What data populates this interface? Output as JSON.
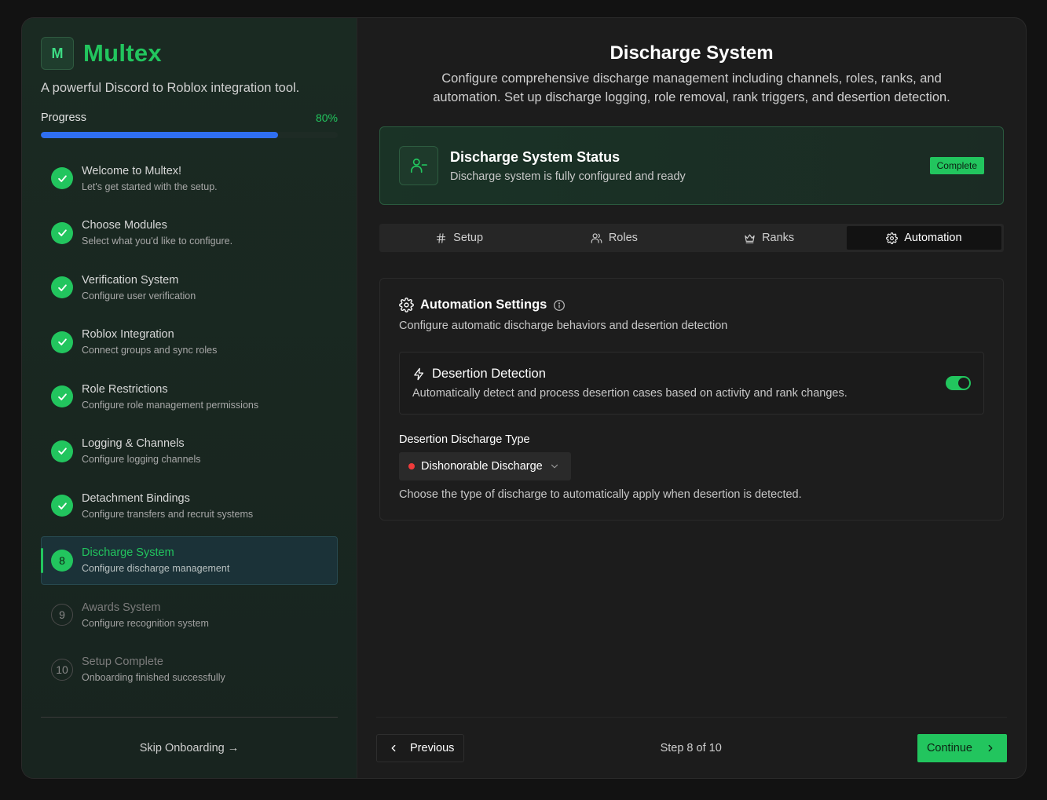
{
  "brand": {
    "logo_letter": "M",
    "name": "Multex",
    "tagline": "A powerful Discord to Roblox integration tool."
  },
  "progress": {
    "label": "Progress",
    "percent_text": "80%",
    "percent": 80
  },
  "steps": [
    {
      "number": "1",
      "title": "Welcome to Multex!",
      "subtitle": "Let's get started with the setup.",
      "state": "done"
    },
    {
      "number": "2",
      "title": "Choose Modules",
      "subtitle": "Select what you'd like to configure.",
      "state": "done"
    },
    {
      "number": "3",
      "title": "Verification System",
      "subtitle": "Configure user verification",
      "state": "done"
    },
    {
      "number": "4",
      "title": "Roblox Integration",
      "subtitle": "Connect groups and sync roles",
      "state": "done"
    },
    {
      "number": "5",
      "title": "Role Restrictions",
      "subtitle": "Configure role management permissions",
      "state": "done"
    },
    {
      "number": "6",
      "title": "Logging & Channels",
      "subtitle": "Configure logging channels",
      "state": "done"
    },
    {
      "number": "7",
      "title": "Detachment Bindings",
      "subtitle": "Configure transfers and recruit systems",
      "state": "done"
    },
    {
      "number": "8",
      "title": "Discharge System",
      "subtitle": "Configure discharge management",
      "state": "active"
    },
    {
      "number": "9",
      "title": "Awards System",
      "subtitle": "Configure recognition system",
      "state": "pending"
    },
    {
      "number": "10",
      "title": "Setup Complete",
      "subtitle": "Onboarding finished successfully",
      "state": "pending"
    }
  ],
  "skip_label": "Skip Onboarding →",
  "page": {
    "title": "Discharge System",
    "description": "Configure comprehensive discharge management including channels, roles, ranks, and automation. Set up discharge logging, role removal, rank triggers, and desertion detection."
  },
  "status": {
    "title": "Discharge System Status",
    "subtitle": "Discharge system is fully configured and ready",
    "badge": "Complete"
  },
  "tabs": [
    {
      "label": "Setup",
      "icon": "hash-icon",
      "active": false
    },
    {
      "label": "Roles",
      "icon": "users-icon",
      "active": false
    },
    {
      "label": "Ranks",
      "icon": "crown-icon",
      "active": false
    },
    {
      "label": "Automation",
      "icon": "gear-icon",
      "active": true
    }
  ],
  "automation": {
    "title": "Automation Settings",
    "subtitle": "Configure automatic discharge behaviors and desertion detection",
    "desertion": {
      "title": "Desertion Detection",
      "description": "Automatically detect and process desertion cases based on activity and rank changes.",
      "enabled": true
    },
    "discharge_type": {
      "label": "Desertion Discharge Type",
      "value": "Dishonorable Discharge",
      "dot_color": "#ef3b3b",
      "helper": "Choose the type of discharge to automatically apply when desertion is detected."
    }
  },
  "footer": {
    "previous": "Previous",
    "step_text": "Step 8 of 10",
    "continue": "Continue"
  },
  "colors": {
    "accent": "#22c55e",
    "progress": "#2f6ff2",
    "background": "#1c1c1c"
  }
}
